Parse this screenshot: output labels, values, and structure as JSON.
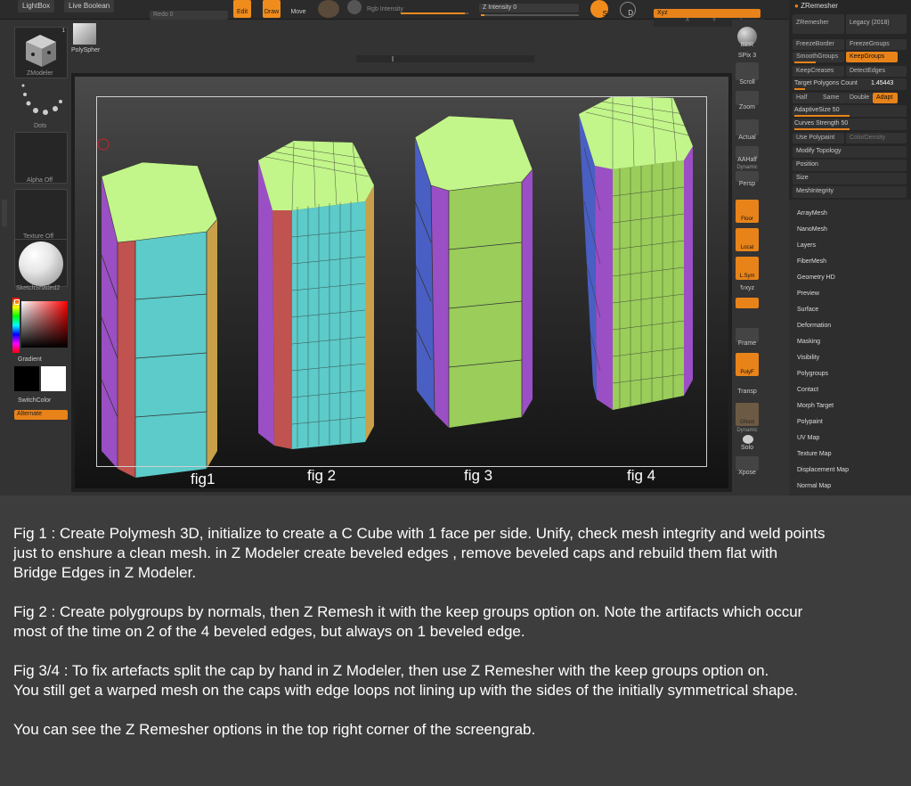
{
  "toolbar": {
    "lightbox": "LightBox",
    "live_boolean": "Live Boolean",
    "redo": "Redo 0",
    "edit": "Edit",
    "draw": "Draw",
    "move": "Move",
    "rgb_intensity": "Rgb Intensity",
    "z_intensity": "Z Intensity 0",
    "xyz": "Xyz",
    "x": "X",
    "y": "Y",
    "z": "Z",
    "s_label": "S",
    "d_label": "D"
  },
  "left_shelf": {
    "zmodeler": "ZModeler",
    "polysphere": "PolySpher",
    "dots": "Dots",
    "alpha_off": "Alpha Off",
    "texture_off": "Texture Off",
    "material": "SketchShaded2",
    "gradient": "Gradient",
    "switch_color": "SwitchColor",
    "alternate": "Alternate",
    "badge": "1"
  },
  "right_shelf": {
    "bpr": "BPR",
    "spix": "SPix 3",
    "scroll": "Scroll",
    "zoom": "Zoom",
    "actual": "Actual",
    "aahalf": "AAHalf",
    "dynamic": "Dynamic",
    "persp": "Persp",
    "floor": "Floor",
    "local": "Local",
    "lsym": "L.Sym",
    "qxyz": "↻xyz",
    "frame": "Frame",
    "polyf": "PolyF",
    "transp": "Transp",
    "ghost": "Ghost",
    "dynamic2": "Dynamic",
    "solo": "Solo",
    "xpose": "Xpose"
  },
  "zremesher": {
    "title": "ZRemesher",
    "zremesher_btn": "ZRemesher",
    "legacy": "Legacy (2018)",
    "freeze_border": "FreezeBorder",
    "freeze_groups": "FreezeGroups",
    "smooth_groups": "SmoothGroups",
    "keep_groups": "KeepGroups",
    "keep_creases": "KeepCreases",
    "detect_edges": "DetectEdges",
    "target_polygons": "Target Polygons Count",
    "target_value": "1.45443",
    "half": "Half",
    "same": "Same",
    "double": "Double",
    "adapt": "Adapt",
    "adaptive_size": "AdaptiveSize 50",
    "curves_strength": "Curves Strength 50",
    "use_polypaint": "Use Polypaint",
    "color_density": "ColorDensity",
    "modify_topology": "Modify Topology",
    "position": "Position",
    "size": "Size",
    "mesh_integrity": "MeshIntegrity"
  },
  "subpalettes": [
    "ArrayMesh",
    "NanoMesh",
    "Layers",
    "FiberMesh",
    "Geometry HD",
    "Preview",
    "Surface",
    "Deformation",
    "Masking",
    "Visibility",
    "Polygroups",
    "Contact",
    "Morph Target",
    "Polypaint",
    "UV Map",
    "Texture Map",
    "Displacement Map",
    "Normal Map"
  ],
  "figures": {
    "fig1": "fig1",
    "fig2": "fig 2",
    "fig3": "fig 3",
    "fig4": "fig 4"
  },
  "colors": {
    "accent": "#e8831a",
    "cap_green": "#c2f58a",
    "side_teal": "#5ccbc9",
    "side_green": "#9acd5a",
    "side_red": "#c0524f",
    "side_purple": "#9b4fc4",
    "side_blue": "#4a5fc4",
    "side_gold": "#c8a04a"
  },
  "caption": {
    "p1_l1": "Fig 1 : Create Polymesh 3D, initialize to create a C Cube with 1 face per side. Unify, check mesh integrity and weld points",
    "p1_l2": "just to enshure a clean mesh. in Z Modeler create beveled edges , remove beveled caps and rebuild them flat with",
    "p1_l3": "Bridge Edges in Z Modeler.",
    "p2_l1": "Fig 2 : Create polygroups by normals, then Z Remesh it with the keep groups option on. Note the artifacts which occur",
    "p2_l2": "most of the time on 2 of the 4 beveled edges, but always on 1 beveled edge.",
    "p3_l1": "Fig 3/4 : To fix artefacts split the cap by hand in Z Modeler, then use Z Remesher with the keep groups option on.",
    "p3_l2": "You still get a warped mesh on the caps with edge loops not lining up with the sides of the initially symmetrical shape.",
    "p4_l1": "You can see the Z Remesher options in the top right corner of the screengrab."
  }
}
